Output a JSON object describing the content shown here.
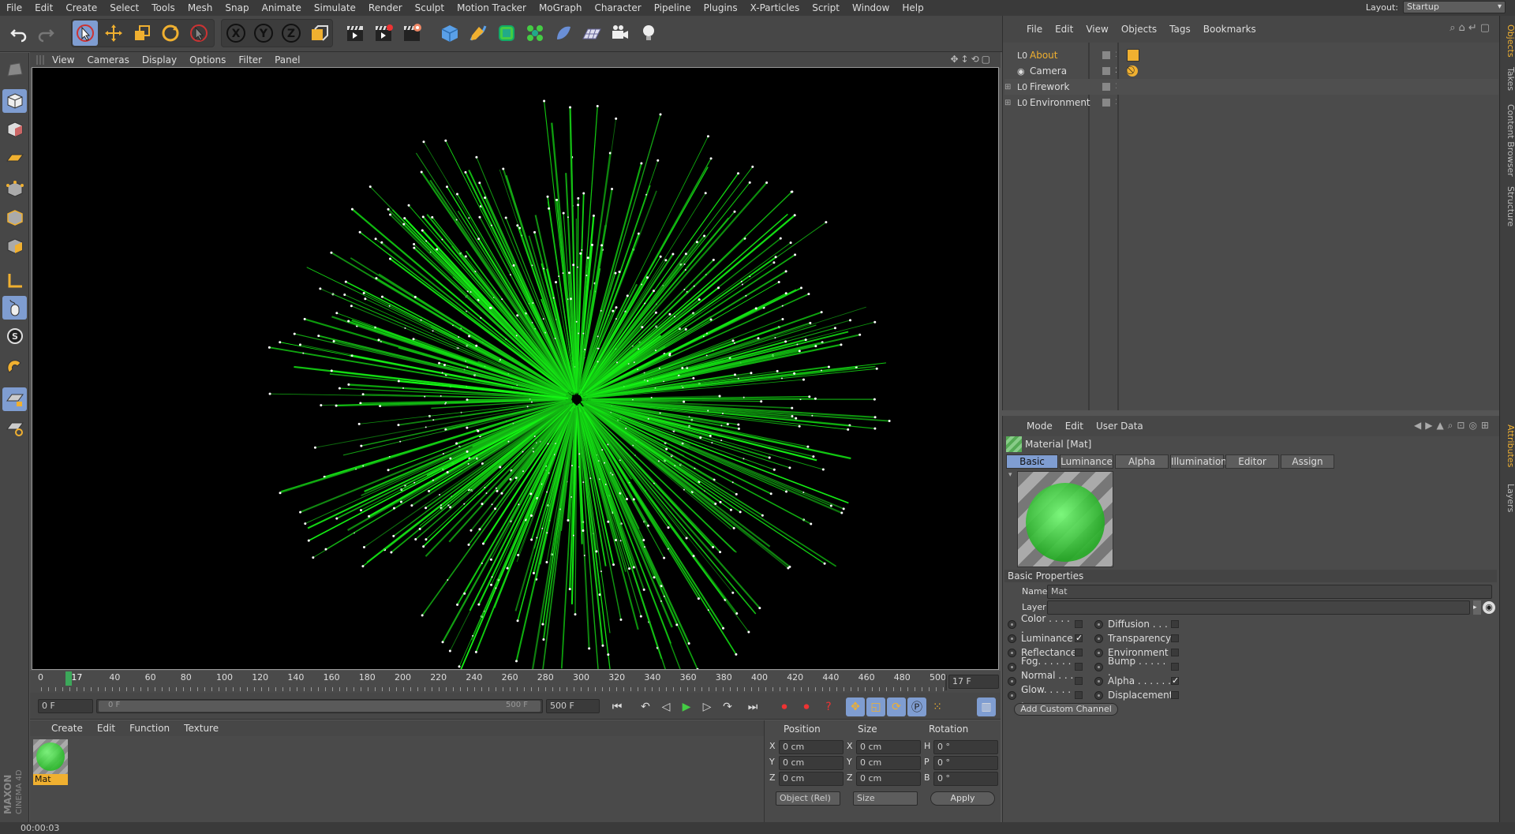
{
  "menubar": {
    "items": [
      "File",
      "Edit",
      "Create",
      "Select",
      "Tools",
      "Mesh",
      "Snap",
      "Animate",
      "Simulate",
      "Render",
      "Sculpt",
      "Motion Tracker",
      "MoGraph",
      "Character",
      "Pipeline",
      "Plugins",
      "X-Particles",
      "Script",
      "Window",
      "Help"
    ],
    "layout_label": "Layout:",
    "layout_value": "Startup"
  },
  "viewport": {
    "menu": [
      "View",
      "Cameras",
      "Display",
      "Options",
      "Filter",
      "Panel"
    ]
  },
  "timeline": {
    "ticks": [
      "0",
      "17",
      "40",
      "60",
      "80",
      "100",
      "120",
      "140",
      "160",
      "180",
      "200",
      "220",
      "240",
      "260",
      "280",
      "300",
      "320",
      "340",
      "360",
      "380",
      "400",
      "420",
      "440",
      "460",
      "480",
      "500"
    ],
    "current_frame": "17 F"
  },
  "transport": {
    "start_field": "0 F",
    "range_start": "0 F",
    "range_end": "500 F",
    "end_field": "500 F"
  },
  "material_manager": {
    "menu": [
      "Create",
      "Edit",
      "Function",
      "Texture"
    ],
    "materials": [
      {
        "name": "Mat"
      }
    ]
  },
  "coordinates": {
    "headers": [
      "Position",
      "Size",
      "Rotation"
    ],
    "rows": [
      {
        "a1": "X",
        "v1": "0 cm",
        "a2": "X",
        "v2": "0 cm",
        "a3": "H",
        "v3": "0 °"
      },
      {
        "a1": "Y",
        "v1": "0 cm",
        "a2": "Y",
        "v2": "0 cm",
        "a3": "P",
        "v3": "0 °"
      },
      {
        "a1": "Z",
        "v1": "0 cm",
        "a2": "Z",
        "v2": "0 cm",
        "a3": "B",
        "v3": "0 °"
      }
    ],
    "mode_select": "Object (Rel)",
    "size_select": "Size",
    "apply_label": "Apply"
  },
  "status": {
    "time": "00:00:03"
  },
  "object_manager": {
    "menu": [
      "File",
      "Edit",
      "View",
      "Objects",
      "Tags",
      "Bookmarks"
    ],
    "objects": [
      {
        "name": "About",
        "highlight": true
      },
      {
        "name": "Camera",
        "highlight": false
      },
      {
        "name": "Firework",
        "highlight": false
      },
      {
        "name": "Environment",
        "highlight": false
      }
    ]
  },
  "attributes": {
    "menu": [
      "Mode",
      "Edit",
      "User Data"
    ],
    "title": "Material [Mat]",
    "tabs": [
      "Basic",
      "Luminance",
      "Alpha",
      "Illumination",
      "Editor",
      "Assign"
    ],
    "section": "Basic Properties",
    "name_label": "Name",
    "name_value": "Mat",
    "layer_label": "Layer",
    "channels_left": [
      {
        "label": "Color . . . . .",
        "checked": false
      },
      {
        "label": "Luminance",
        "checked": true
      },
      {
        "label": "Reflectance",
        "checked": false
      },
      {
        "label": "Fog. . . . . . .",
        "checked": false
      },
      {
        "label": "Normal . . . .",
        "checked": false
      },
      {
        "label": "Glow. . . . . .",
        "checked": false
      }
    ],
    "channels_right": [
      {
        "label": "Diffusion . . .",
        "checked": false
      },
      {
        "label": "Transparency",
        "checked": false
      },
      {
        "label": "Environment",
        "checked": false
      },
      {
        "label": "Bump . . . . . .",
        "checked": false
      },
      {
        "label": "Alpha . . . . . .",
        "checked": true
      },
      {
        "label": "Displacement",
        "checked": false
      }
    ],
    "add_channel": "Add Custom Channel"
  },
  "right_tabs": [
    "Objects",
    "Takes",
    "Content Browser",
    "Structure",
    "Attributes",
    "Layers"
  ],
  "logo": {
    "text1": "MAXON",
    "text2": "CINEMA 4D"
  },
  "colors": {
    "accent": "#7f9dd1",
    "firework": "#22dd22",
    "highlight": "#f0b030"
  }
}
